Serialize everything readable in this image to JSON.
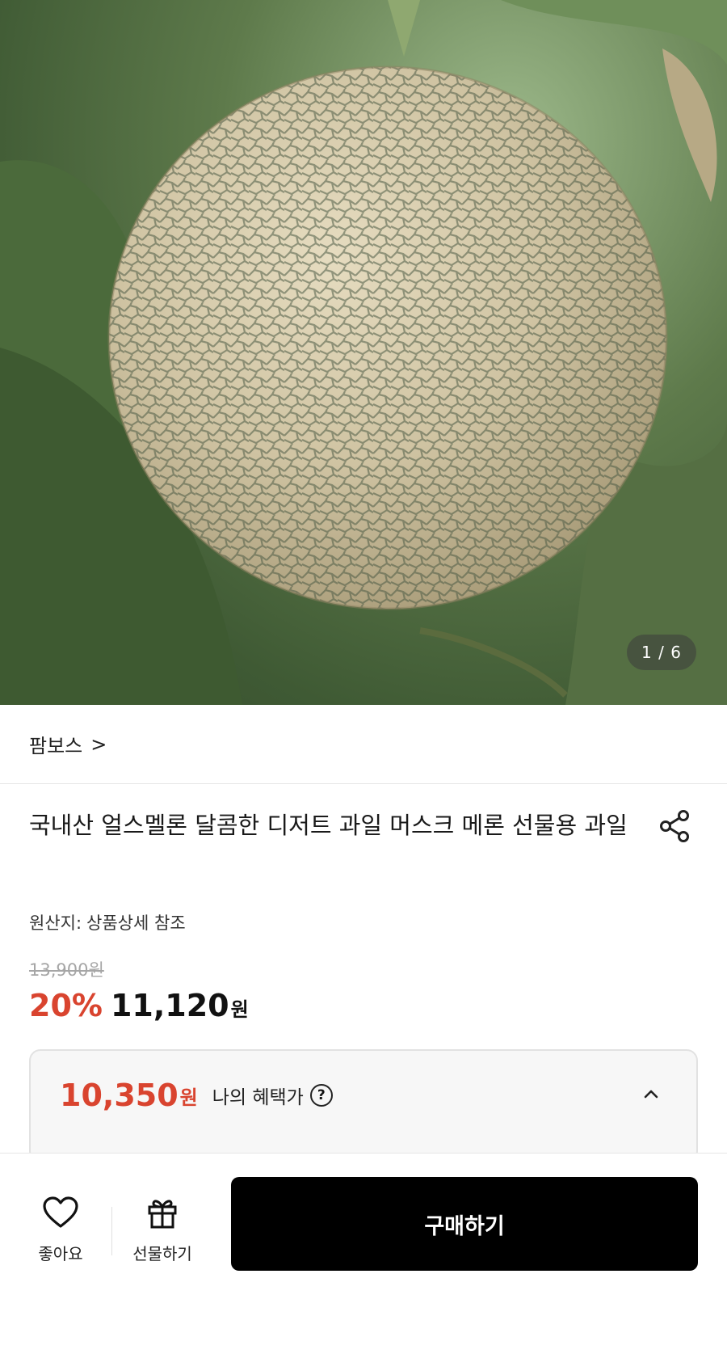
{
  "gallery": {
    "image_description_icon": "melon-photo",
    "counter": "1 / 6"
  },
  "store": {
    "name": "팜보스",
    "chevron": ">"
  },
  "product": {
    "title": "국내산 얼스멜론 달콤한 디저트 과일 머스크 메론 선물용 과일",
    "origin_label": "원산지:",
    "origin_value": "상품상세 참조",
    "original_price": "13,900원",
    "discount": "20%",
    "sale_price": "11,120",
    "currency": "원"
  },
  "benefit": {
    "price": "10,350",
    "currency": "원",
    "label": "나의 혜택가",
    "help": "?"
  },
  "bottom_bar": {
    "like_label": "좋아요",
    "gift_label": "선물하기",
    "buy_label": "구매하기"
  },
  "colors": {
    "accent_red": "#d9442f",
    "buy_button": "#000000"
  }
}
